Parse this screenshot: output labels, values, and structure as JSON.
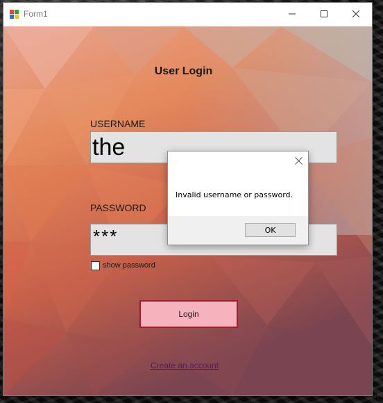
{
  "window": {
    "title": "Form1"
  },
  "form": {
    "heading": "User Login",
    "username_label": "USERNAME",
    "username_value": "the",
    "password_label": "PASSWORD",
    "password_value": "***",
    "show_password_label": "show password",
    "show_password_checked": false,
    "login_button": "Login",
    "create_account_link": "Create an account"
  },
  "dialog": {
    "message": "Invalid username or password.",
    "ok_button": "OK"
  },
  "colors": {
    "login_button_bg": "#f7b3bd",
    "login_button_border": "#a21c2a",
    "link": "#5a1a5a"
  },
  "icons": {
    "app": "winforms-app-icon",
    "minimize": "minimize-icon",
    "maximize": "maximize-icon",
    "close": "close-icon",
    "dialog_close": "close-icon"
  }
}
